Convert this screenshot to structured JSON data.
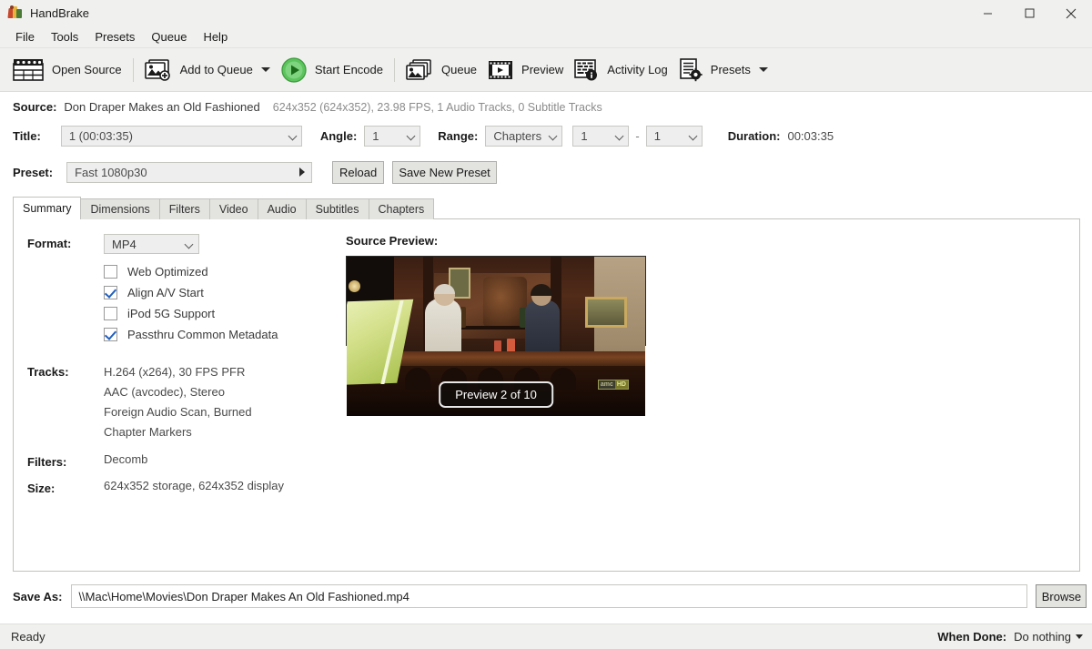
{
  "window": {
    "title": "HandBrake",
    "app_icon": "handbrake-cocktail-icon",
    "controls": {
      "minimize": "minimize-icon",
      "maximize": "maximize-icon",
      "close": "close-icon"
    }
  },
  "menubar": {
    "items": [
      {
        "label": "File"
      },
      {
        "label": "Tools"
      },
      {
        "label": "Presets"
      },
      {
        "label": "Queue"
      },
      {
        "label": "Help"
      }
    ]
  },
  "toolbar": {
    "items": [
      {
        "label": "Open Source",
        "icon": "film-clapper-icon",
        "has_caret": false
      },
      {
        "label": "Add to Queue",
        "icon": "add-image-icon",
        "has_caret": true
      },
      {
        "label": "Start Encode",
        "icon": "play-circle-icon",
        "has_caret": false
      },
      {
        "label": "Queue",
        "icon": "stacked-images-icon",
        "has_caret": false
      },
      {
        "label": "Preview",
        "icon": "film-strip-play-icon",
        "has_caret": false
      },
      {
        "label": "Activity Log",
        "icon": "log-info-icon",
        "has_caret": false
      },
      {
        "label": "Presets",
        "icon": "document-gear-icon",
        "has_caret": true
      }
    ]
  },
  "source": {
    "label": "Source:",
    "name": "Don Draper Makes an Old Fashioned",
    "meta": "624x352 (624x352), 23.98 FPS, 1 Audio Tracks, 0 Subtitle Tracks"
  },
  "title_row": {
    "title_label": "Title:",
    "title_value": "1  (00:03:35)",
    "angle_label": "Angle:",
    "angle_value": "1",
    "range_label": "Range:",
    "range_value": "Chapters",
    "range_start": "1",
    "range_separator": "-",
    "range_end": "1",
    "duration_label": "Duration:",
    "duration_value": "00:03:35"
  },
  "preset_row": {
    "label": "Preset:",
    "value": "Fast 1080p30",
    "reload_label": "Reload",
    "save_label": "Save New Preset"
  },
  "tabs": [
    {
      "label": "Summary",
      "active": true
    },
    {
      "label": "Dimensions",
      "active": false
    },
    {
      "label": "Filters",
      "active": false
    },
    {
      "label": "Video",
      "active": false
    },
    {
      "label": "Audio",
      "active": false
    },
    {
      "label": "Subtitles",
      "active": false
    },
    {
      "label": "Chapters",
      "active": false
    }
  ],
  "summary": {
    "format_label": "Format:",
    "format_value": "MP4",
    "checkboxes": [
      {
        "label": "Web Optimized",
        "checked": false
      },
      {
        "label": "Align A/V Start",
        "checked": true
      },
      {
        "label": "iPod 5G Support",
        "checked": false
      },
      {
        "label": "Passthru Common Metadata",
        "checked": true
      }
    ],
    "tracks_label": "Tracks:",
    "tracks": [
      "H.264 (x264), 30 FPS PFR",
      "AAC (avcodec), Stereo",
      "Foreign Audio Scan, Burned",
      "Chapter Markers"
    ],
    "filters_label": "Filters:",
    "filters_value": "Decomb",
    "size_label": "Size:",
    "size_value": "624x352 storage, 624x352 display"
  },
  "preview": {
    "title": "Source Preview:",
    "badge": "Preview 2 of 10",
    "prev_button": "<",
    "next_button": ">",
    "watermark_left": "amc",
    "watermark_right": "HD"
  },
  "save_as": {
    "label": "Save As:",
    "value": "\\\\Mac\\Home\\Movies\\Don Draper Makes An Old Fashioned.mp4",
    "browse_label": "Browse"
  },
  "statusbar": {
    "status": "Ready",
    "when_done_label": "When Done:",
    "when_done_value": "Do nothing"
  },
  "colors": {
    "window_bg": "#f0f0ee",
    "panel_bg": "#ffffff",
    "accent_check": "#1f5fbf",
    "play_green": "#5cc45c",
    "button_face": "#e3e3e0"
  }
}
